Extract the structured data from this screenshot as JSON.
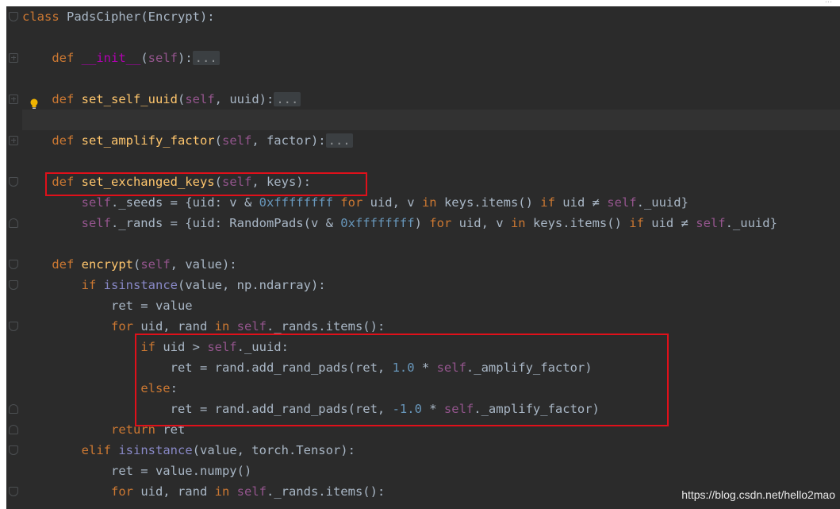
{
  "top_text": "...",
  "watermark": "https://blog.csdn.net/hello2mao",
  "code_lines": [
    [
      {
        "t": "class ",
        "c": "kw"
      },
      {
        "t": "PadsCipher(Encrypt):",
        "c": ""
      }
    ],
    [],
    [
      {
        "t": "    def ",
        "c": "kw"
      },
      {
        "t": "__init__",
        "c": "dunder"
      },
      {
        "t": "(",
        "c": ""
      },
      {
        "t": "self",
        "c": "sf"
      },
      {
        "t": "):",
        "c": ""
      },
      {
        "t": "...",
        "c": "fold-dots"
      }
    ],
    [],
    [
      {
        "t": "    def ",
        "c": "kw"
      },
      {
        "t": "set_self_uuid",
        "c": "fn"
      },
      {
        "t": "(",
        "c": ""
      },
      {
        "t": "self",
        "c": "sf"
      },
      {
        "t": ", uuid):",
        "c": ""
      },
      {
        "t": "...",
        "c": "fold-dots"
      }
    ],
    [],
    [
      {
        "t": "    def ",
        "c": "kw"
      },
      {
        "t": "set_amplify_factor",
        "c": "fn"
      },
      {
        "t": "(",
        "c": ""
      },
      {
        "t": "self",
        "c": "sf"
      },
      {
        "t": ", factor):",
        "c": ""
      },
      {
        "t": "...",
        "c": "fold-dots"
      }
    ],
    [],
    [
      {
        "t": "    def ",
        "c": "kw"
      },
      {
        "t": "set_exchanged_keys",
        "c": "fn"
      },
      {
        "t": "(",
        "c": ""
      },
      {
        "t": "self",
        "c": "sf"
      },
      {
        "t": ", keys):",
        "c": ""
      }
    ],
    [
      {
        "t": "        ",
        "c": ""
      },
      {
        "t": "self",
        "c": "sf"
      },
      {
        "t": "._seeds = {uid: v & ",
        "c": ""
      },
      {
        "t": "0xffffffff",
        "c": "num"
      },
      {
        "t": " ",
        "c": ""
      },
      {
        "t": "for",
        "c": "kw"
      },
      {
        "t": " uid, v ",
        "c": ""
      },
      {
        "t": "in",
        "c": "kw"
      },
      {
        "t": " keys.items() ",
        "c": ""
      },
      {
        "t": "if",
        "c": "kw"
      },
      {
        "t": " uid ≠ ",
        "c": ""
      },
      {
        "t": "self",
        "c": "sf"
      },
      {
        "t": "._uuid}",
        "c": ""
      }
    ],
    [
      {
        "t": "        ",
        "c": ""
      },
      {
        "t": "self",
        "c": "sf"
      },
      {
        "t": "._rands = {uid: RandomPads(v & ",
        "c": ""
      },
      {
        "t": "0xffffffff",
        "c": "num"
      },
      {
        "t": ") ",
        "c": ""
      },
      {
        "t": "for",
        "c": "kw"
      },
      {
        "t": " uid, v ",
        "c": ""
      },
      {
        "t": "in",
        "c": "kw"
      },
      {
        "t": " keys.items() ",
        "c": ""
      },
      {
        "t": "if",
        "c": "kw"
      },
      {
        "t": " uid ≠ ",
        "c": ""
      },
      {
        "t": "self",
        "c": "sf"
      },
      {
        "t": "._uuid}",
        "c": ""
      }
    ],
    [],
    [
      {
        "t": "    def ",
        "c": "kw"
      },
      {
        "t": "encrypt",
        "c": "fn"
      },
      {
        "t": "(",
        "c": ""
      },
      {
        "t": "self",
        "c": "sf"
      },
      {
        "t": ", value):",
        "c": ""
      }
    ],
    [
      {
        "t": "        ",
        "c": ""
      },
      {
        "t": "if",
        "c": "kw"
      },
      {
        "t": " ",
        "c": ""
      },
      {
        "t": "isinstance",
        "c": "bi"
      },
      {
        "t": "(value, np.ndarray):",
        "c": ""
      }
    ],
    [
      {
        "t": "            ret = value",
        "c": ""
      }
    ],
    [
      {
        "t": "            ",
        "c": ""
      },
      {
        "t": "for",
        "c": "kw"
      },
      {
        "t": " uid, rand ",
        "c": ""
      },
      {
        "t": "in",
        "c": "kw"
      },
      {
        "t": " ",
        "c": ""
      },
      {
        "t": "self",
        "c": "sf"
      },
      {
        "t": "._rands.items():",
        "c": ""
      }
    ],
    [
      {
        "t": "                ",
        "c": ""
      },
      {
        "t": "if",
        "c": "kw"
      },
      {
        "t": " uid > ",
        "c": ""
      },
      {
        "t": "self",
        "c": "sf"
      },
      {
        "t": "._uuid:",
        "c": ""
      }
    ],
    [
      {
        "t": "                    ret = rand.add_rand_pads(ret, ",
        "c": ""
      },
      {
        "t": "1.0",
        "c": "num"
      },
      {
        "t": " * ",
        "c": ""
      },
      {
        "t": "self",
        "c": "sf"
      },
      {
        "t": "._amplify_factor)",
        "c": ""
      }
    ],
    [
      {
        "t": "                ",
        "c": ""
      },
      {
        "t": "else",
        "c": "kw"
      },
      {
        "t": ":",
        "c": ""
      }
    ],
    [
      {
        "t": "                    ret = rand.add_rand_pads(ret, ",
        "c": ""
      },
      {
        "t": "-1.0",
        "c": "num"
      },
      {
        "t": " * ",
        "c": ""
      },
      {
        "t": "self",
        "c": "sf"
      },
      {
        "t": "._amplify_factor)",
        "c": ""
      }
    ],
    [
      {
        "t": "            ",
        "c": ""
      },
      {
        "t": "return",
        "c": "kw"
      },
      {
        "t": " ret",
        "c": ""
      }
    ],
    [
      {
        "t": "        ",
        "c": ""
      },
      {
        "t": "elif",
        "c": "kw"
      },
      {
        "t": " ",
        "c": ""
      },
      {
        "t": "isinstance",
        "c": "bi"
      },
      {
        "t": "(value, torch.Tensor):",
        "c": ""
      }
    ],
    [
      {
        "t": "            ret = value.numpy()",
        "c": ""
      }
    ],
    [
      {
        "t": "            ",
        "c": ""
      },
      {
        "t": "for",
        "c": "kw"
      },
      {
        "t": " uid, rand ",
        "c": ""
      },
      {
        "t": "in",
        "c": "kw"
      },
      {
        "t": " ",
        "c": ""
      },
      {
        "t": "self",
        "c": "sf"
      },
      {
        "t": "._rands.items():",
        "c": ""
      }
    ]
  ]
}
